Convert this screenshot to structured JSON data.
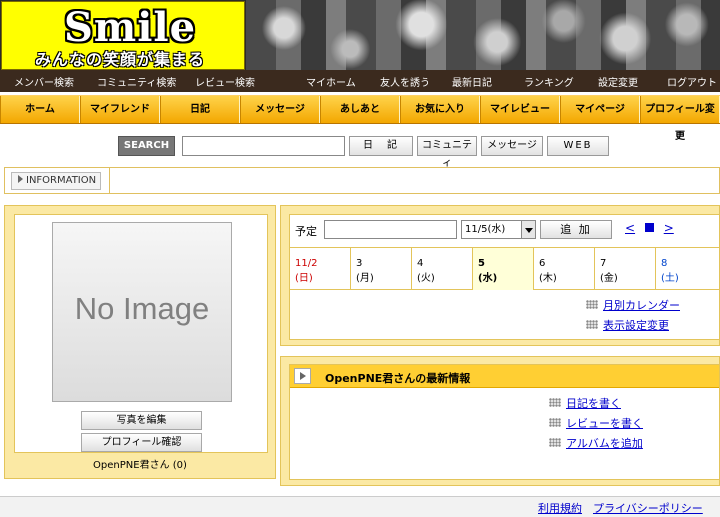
{
  "logo": {
    "title": "Smile",
    "tagline": "みんなの笑顔が集まる"
  },
  "top_nav": {
    "left": [
      "メンバー検索",
      "コミュニティ検索",
      "レビュー検索"
    ],
    "right": [
      "マイホーム",
      "友人を誘う",
      "最新日記",
      "ランキング",
      "設定変更",
      "ログアウト"
    ]
  },
  "menu": [
    "ホーム",
    "マイフレンド",
    "日記",
    "メッセージ",
    "あしあと",
    "お気に入り",
    "マイレビュー",
    "マイページ",
    "プロフィール変更"
  ],
  "search": {
    "label": "SEARCH",
    "value": "",
    "buttons": [
      "日　記",
      "コミュニティ",
      "メッセージ",
      "WEB"
    ]
  },
  "information": {
    "label": "INFORMATION"
  },
  "profile": {
    "image_text": "No Image",
    "edit_photo": "写真を編集",
    "check_profile": "プロフィール確認",
    "name": "OpenPNE君さん (0)"
  },
  "calendar": {
    "schedule_label": "予定",
    "schedule_value": "",
    "selected_date": "11/5(水)",
    "add_label": "追 加",
    "nav_prev": "<",
    "nav_next": ">",
    "days": [
      {
        "date": "11/2",
        "dow": "(日)",
        "kind": "sun"
      },
      {
        "date": "3",
        "dow": "(月)",
        "kind": ""
      },
      {
        "date": "4",
        "dow": "(火)",
        "kind": ""
      },
      {
        "date": "5",
        "dow": "(水)",
        "kind": "today"
      },
      {
        "date": "6",
        "dow": "(木)",
        "kind": ""
      },
      {
        "date": "7",
        "dow": "(金)",
        "kind": ""
      },
      {
        "date": "8",
        "dow": "(土)",
        "kind": "sat"
      }
    ],
    "links": [
      "月別カレンダー",
      "表示設定変更"
    ]
  },
  "news": {
    "title": "OpenPNE君さんの最新情報",
    "links": [
      "日記を書く",
      "レビューを書く",
      "アルバムを追加"
    ]
  },
  "footer": {
    "terms": "利用規約",
    "privacy": "プライバシーポリシー"
  },
  "colors": {
    "menu_orange": "#f0a800",
    "panel_yellow": "#fbe9a4",
    "link_blue": "#0000cc",
    "logo_yellow": "#ffff00"
  }
}
